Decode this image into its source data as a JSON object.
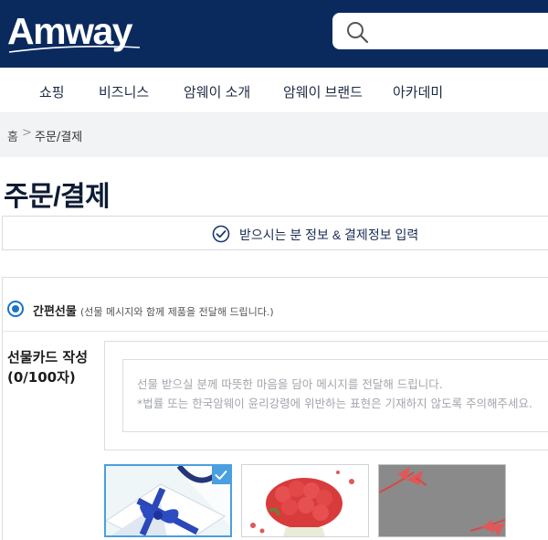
{
  "header": {
    "logo_text": "Amway",
    "search_icon": "search-icon"
  },
  "nav": {
    "items": [
      {
        "label": "쇼핑"
      },
      {
        "label": "비즈니스"
      },
      {
        "label": "암웨이 소개"
      },
      {
        "label": "암웨이 브랜드"
      },
      {
        "label": "아카데미"
      }
    ]
  },
  "breadcrumb": {
    "home": "홈",
    "separator": ">",
    "current": "주문/결제"
  },
  "page": {
    "title": "주문/결제",
    "step_label": "받으시는 분 정보 & 결제정보 입력",
    "step_icon": "check-circle-icon"
  },
  "gift_option": {
    "label": "간편선물",
    "note": "(선물 메시지와 함께 제품을 전달해 드립니다.)",
    "selected": true
  },
  "gift_card": {
    "label_line1": "선물카드 작성",
    "label_line2": "(0/100자)",
    "placeholder_line1": "선물 받으실 분께 따뜻한 마음을 담아 메시지를 전달해 드립니다.",
    "placeholder_line2": "*법률 또는 한국암웨이 윤리강령에 위반하는 표현은 기재하지 않도록 주의해주세요."
  },
  "gift_designs": [
    {
      "name": "blue-ribbon-gift-box",
      "selected": true
    },
    {
      "name": "red-roses-bouquet",
      "selected": false
    },
    {
      "name": "grey-ribbon-wrap",
      "selected": false
    }
  ],
  "colors": {
    "header_bg": "#0a2a5e",
    "accent": "#1a73c4",
    "thumb_select": "#4a9fe0"
  }
}
